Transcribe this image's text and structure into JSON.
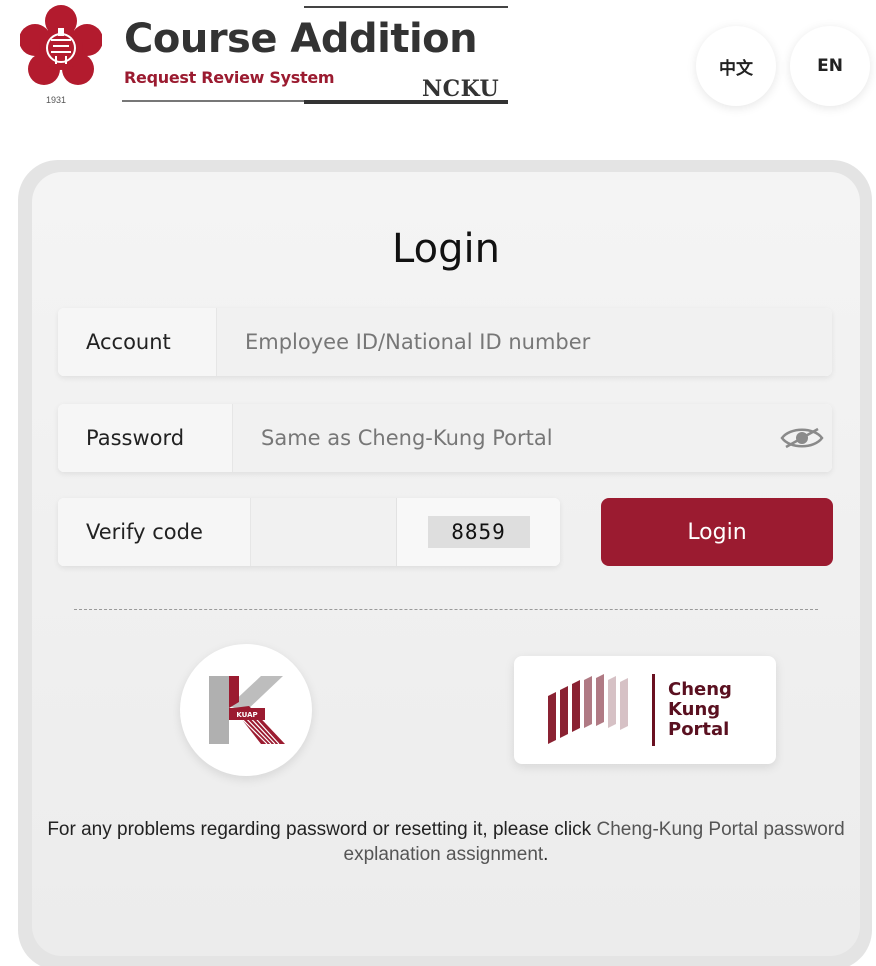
{
  "header": {
    "logo_year": "1931",
    "brand_title": "Course Addition",
    "brand_subtitle": "Request Review System",
    "brand_ncku": "NCKU",
    "lang_zh": "中文",
    "lang_en": "EN"
  },
  "login": {
    "title": "Login",
    "account_label": "Account",
    "account_placeholder": "Employee ID/National ID number",
    "password_label": "Password",
    "password_placeholder": "Same as Cheng-Kung Portal",
    "verify_label": "Verify code",
    "verify_value": "",
    "captcha_text": "8859",
    "submit_label": "Login"
  },
  "sso": {
    "kuap_label": "KUAP",
    "portal_line1": "Cheng",
    "portal_line2": "Kung",
    "portal_line3": "Portal"
  },
  "help": {
    "text": "For any problems regarding password or resetting it, please click ",
    "link_text": "Cheng-Kung Portal password explanation assignment",
    "suffix": "."
  },
  "colors": {
    "brand_red": "#9b1b30",
    "portal_maroon": "#5a1020"
  },
  "icons": {
    "password_toggle": "eye-icon",
    "logo": "ncku-emblem-icon"
  }
}
